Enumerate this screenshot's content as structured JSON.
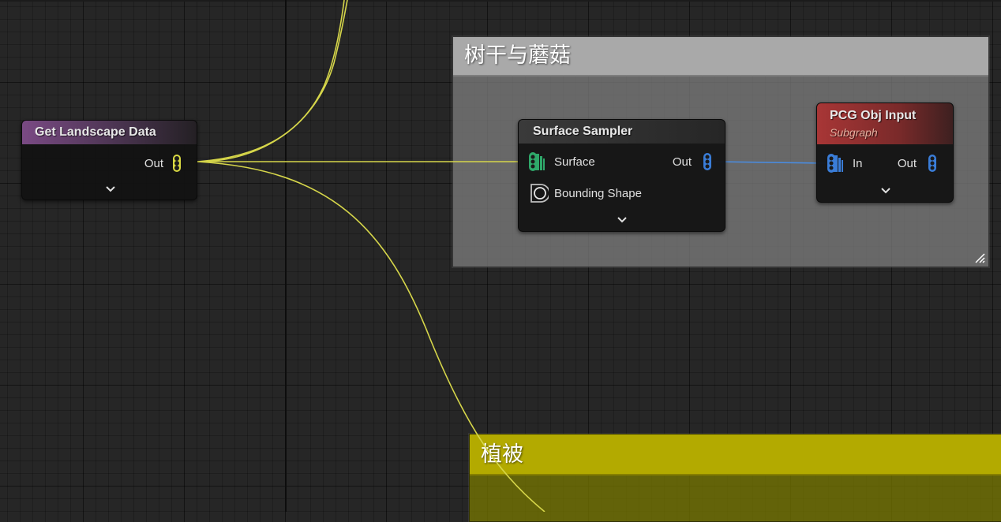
{
  "comments": {
    "trees": {
      "title": "树干与蘑菇",
      "color": "#a9a9a9"
    },
    "vegetation": {
      "title": "植被",
      "color": "#b3aa00"
    }
  },
  "nodes": {
    "get_landscape_data": {
      "title": "Get Landscape Data",
      "header_color": "#7a4a84",
      "outputs": [
        {
          "label": "Out",
          "pin_color": "#d9d942",
          "icon": "point-data-pin-icon"
        }
      ]
    },
    "surface_sampler": {
      "title": "Surface Sampler",
      "inputs": [
        {
          "label": "Surface",
          "pin_color": "#2fa86a",
          "icon": "surface-pin-icon"
        },
        {
          "label": "Bounding Shape",
          "pin_color": "#bfbfbf",
          "icon": "spatial-pin-icon"
        }
      ],
      "outputs": [
        {
          "label": "Out",
          "pin_color": "#3a7dd8",
          "icon": "point-pin-icon"
        }
      ]
    },
    "pcg_obj_input": {
      "title": "PCG Obj Input",
      "subtitle": "Subgraph",
      "header_color": "#a83636",
      "inputs": [
        {
          "label": "In",
          "pin_color": "#3a7dd8",
          "icon": "point-pin-icon"
        }
      ],
      "outputs": [
        {
          "label": "Out",
          "pin_color": "#3a7dd8",
          "icon": "point-pin-icon"
        }
      ]
    }
  },
  "wire_colors": {
    "landscape": "#d6d64a",
    "points": "#4a8ce0"
  }
}
